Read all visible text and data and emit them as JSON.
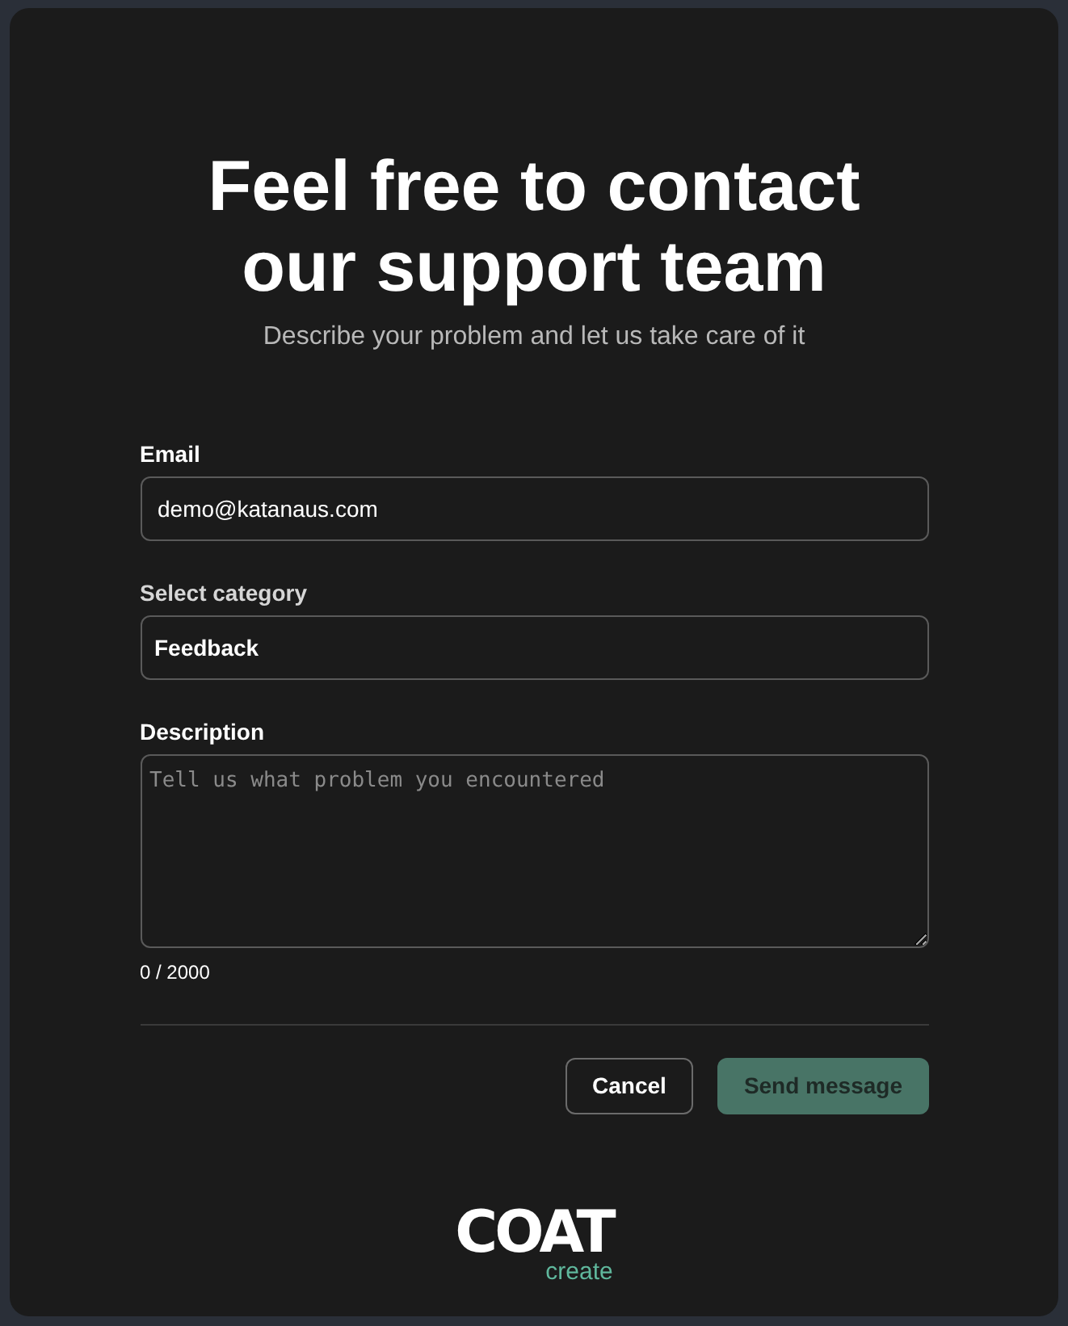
{
  "dialog": {
    "title": "Feel free to contact our support team",
    "subtitle": "Describe your problem and let us take care of it"
  },
  "form": {
    "email": {
      "label": "Email",
      "value": "demo@katanaus.com"
    },
    "category": {
      "label": "Select category",
      "value": "Feedback"
    },
    "description": {
      "label": "Description",
      "placeholder": "Tell us what problem you encountered",
      "counter": "0 / 2000"
    }
  },
  "buttons": [
    {
      "kind": "secondary",
      "label": "Cancel",
      "disabled": false
    },
    {
      "kind": "primary",
      "label": "Send message",
      "disabled": true
    }
  ],
  "logo": {
    "wordmark": "COAT",
    "tagline": "create"
  }
}
